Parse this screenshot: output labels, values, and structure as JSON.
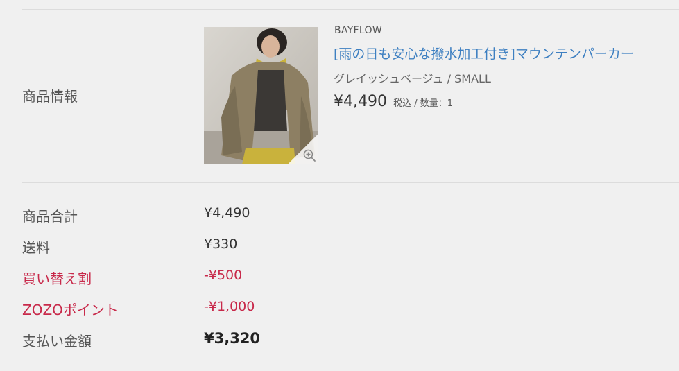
{
  "product_section": {
    "label": "商品情報",
    "brand": "BAYFLOW",
    "name": "[雨の日も安心な撥水加工付き]マウンテンパーカー",
    "variant": "グレイッシュベージュ / SMALL",
    "price": "¥4,490",
    "price_meta": "税込 / 数量：1",
    "zoom_icon": "zoom-in-icon"
  },
  "summary": {
    "rows": [
      {
        "label": "商品合計",
        "value": "¥4,490"
      },
      {
        "label": "送料",
        "value": "¥330"
      },
      {
        "label": "買い替え割",
        "value": "-¥500"
      },
      {
        "label": "ZOZOポイント",
        "value": "-¥1,000"
      },
      {
        "label": "支払い金額",
        "value": "¥3,320"
      }
    ]
  },
  "colors": {
    "link": "#3d7fc1",
    "discount": "#c8294a",
    "background": "#f0f0f0"
  }
}
